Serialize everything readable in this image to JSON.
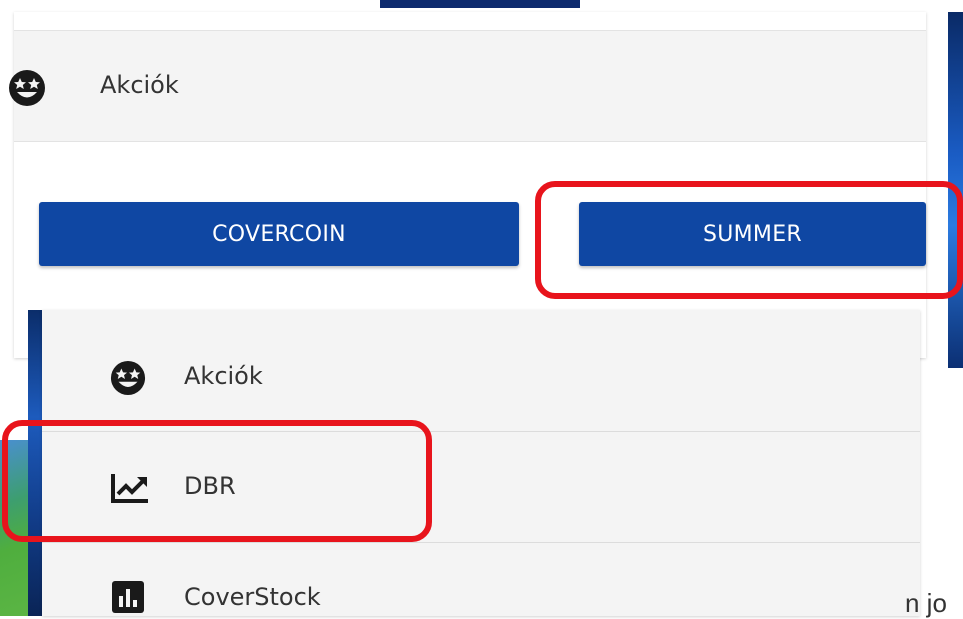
{
  "top_panel": {
    "menu_item": {
      "label": "Akciók",
      "icon": "star-eyes-emoji-icon"
    },
    "buttons": [
      {
        "label": "COVERCOIN"
      },
      {
        "label": "SUMMER"
      }
    ]
  },
  "bottom_menu": {
    "items": [
      {
        "label": "Akciók",
        "icon": "star-eyes-emoji-icon"
      },
      {
        "label": "DBR",
        "icon": "trending-up-chart-icon"
      },
      {
        "label": "CoverStock",
        "icon": "bar-chart-icon"
      }
    ]
  },
  "trailing_text": "n jo",
  "colors": {
    "button_bg": "#0f47a3",
    "highlight": "#e8141c",
    "row_bg": "#f4f4f4"
  }
}
